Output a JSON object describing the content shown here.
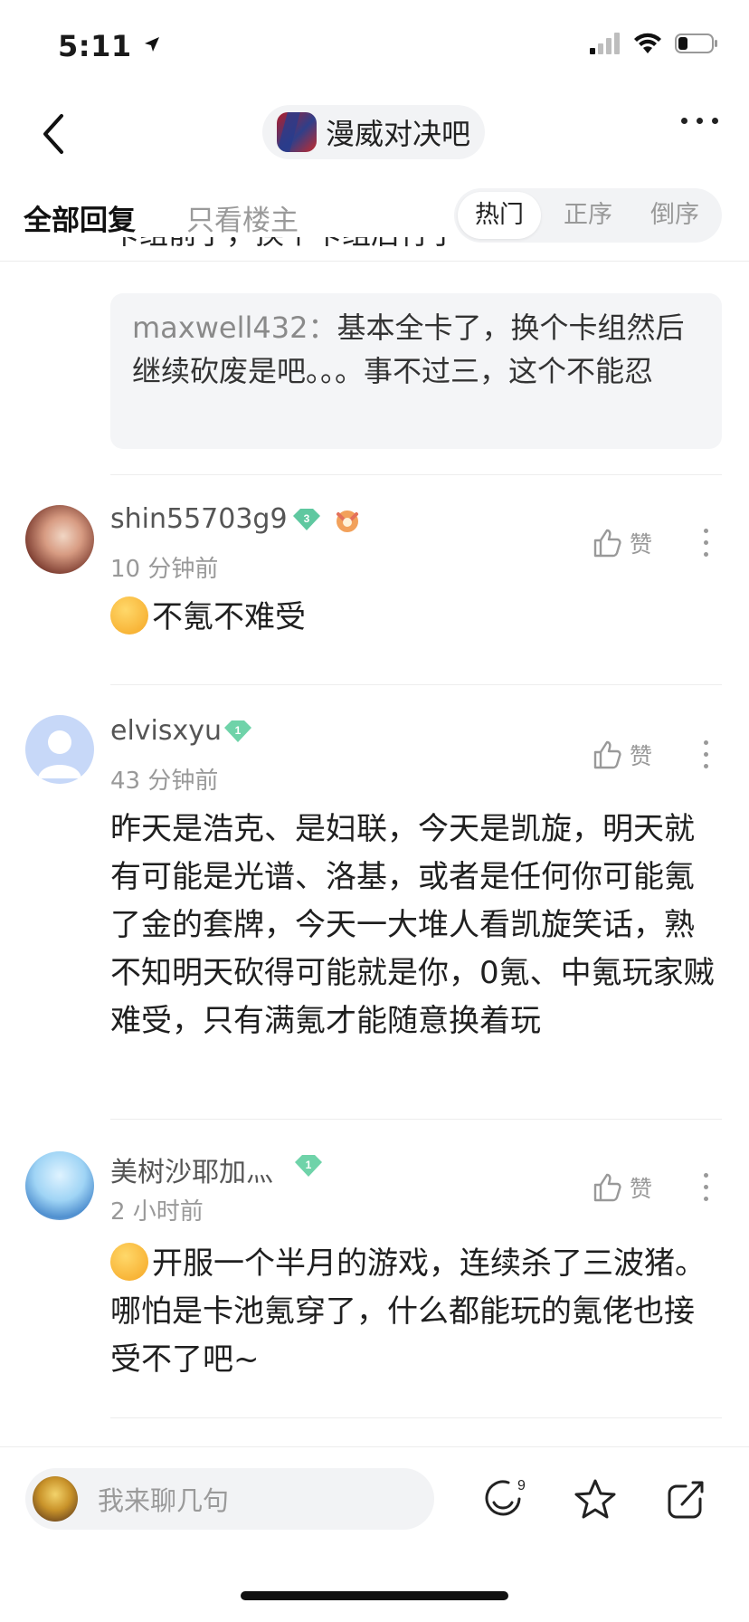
{
  "status_bar": {
    "time": "5:11"
  },
  "header": {
    "forum_name": "漫威对决吧"
  },
  "tabs": {
    "all": "全部回复",
    "op_only": "只看楼主"
  },
  "sort": {
    "hot": "热门",
    "asc": "正序",
    "desc": "倒序"
  },
  "top_reply": {
    "cut_text": "卡组前了，换个卡组后行了",
    "quote_user": "maxwell432：",
    "quote_text": "基本全卡了，换个卡组然后继续砍废是吧。。。事不过三，这个不能忍"
  },
  "posts": [
    {
      "username": "shin55703g9",
      "level": "3",
      "time": "10 分钟前",
      "text": "不氪不难受",
      "like_label": "赞"
    },
    {
      "username": "elvisxyu",
      "level": "1",
      "time": "43 分钟前",
      "text": "昨天是浩克、是妇联，今天是凯旋，明天就有可能是光谱、洛基，或者是任何你可能氪了金的套牌，今天一大堆人看凯旋笑话，熟不知明天砍得可能就是你，0氪、中氪玩家贼难受，只有满氪才能随意换着玩",
      "like_label": "赞"
    },
    {
      "username": "美树沙耶加灬",
      "level": "1",
      "time": "2 小时前",
      "text": "开服一个半月的游戏，连续杀了三波猪。哪怕是卡池氪穿了，什么都能玩的氪佬也接受不了吧~",
      "like_label": "赞"
    }
  ],
  "bottom_bar": {
    "placeholder": "我来聊几句",
    "emoji_count": "9"
  }
}
